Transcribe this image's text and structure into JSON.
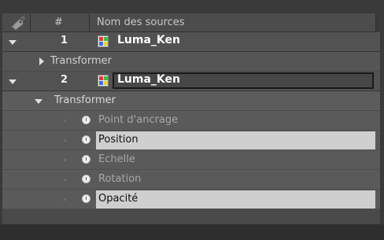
{
  "header": {
    "hash_label": "#",
    "name_label": "Nom des sources"
  },
  "layers": [
    {
      "number": "1",
      "name": "Luma_Ken",
      "group_label": "Transformer"
    },
    {
      "number": "2",
      "name": "Luma_Ken",
      "group_label": "Transformer"
    }
  ],
  "properties": [
    {
      "label": "Point d'ancrage"
    },
    {
      "label": "Position"
    },
    {
      "label": "Echelle"
    },
    {
      "label": "Rotation"
    },
    {
      "label": "Opacité"
    }
  ]
}
